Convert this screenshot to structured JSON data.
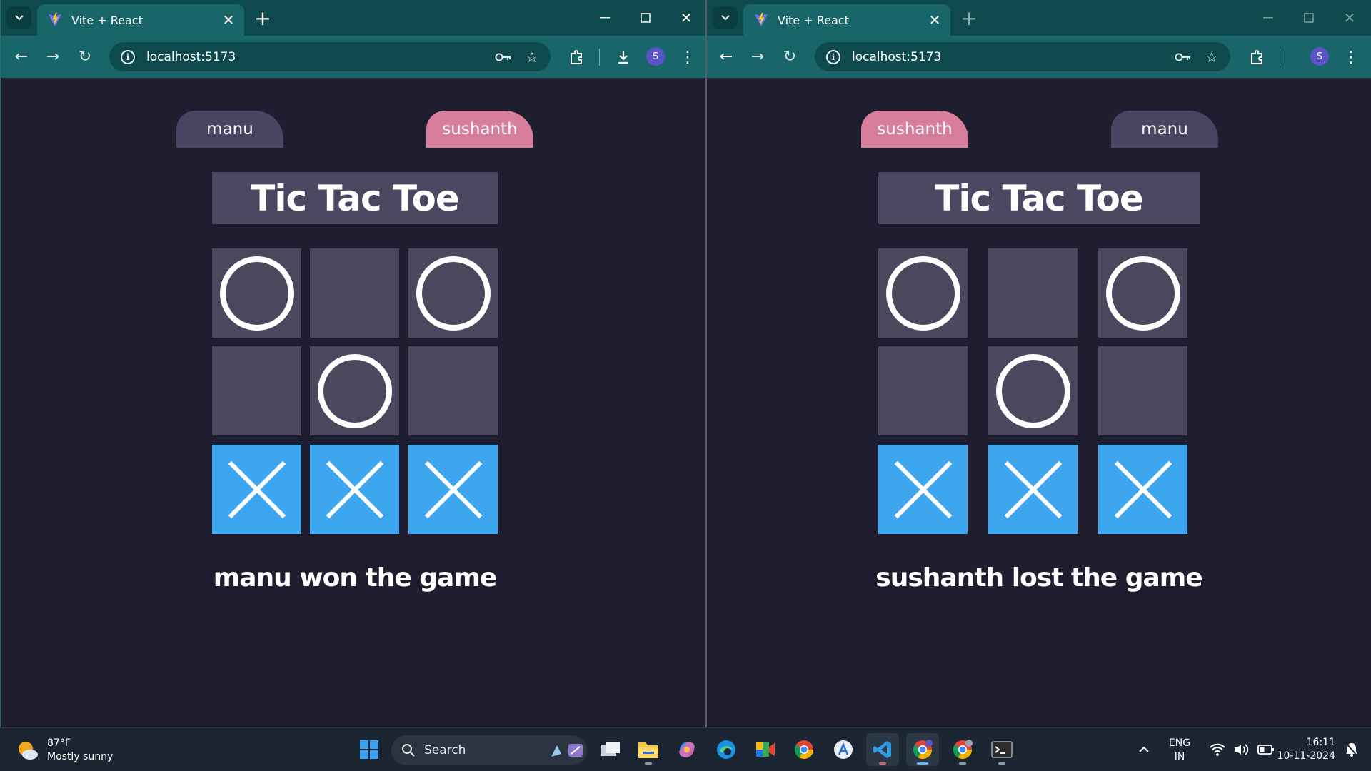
{
  "browsers": [
    {
      "id": "left",
      "tab_title": "Vite + React",
      "url": "localhost:5173",
      "profile_initial": "S",
      "players": [
        {
          "name": "manu",
          "active": false
        },
        {
          "name": "sushanth",
          "active": true
        }
      ],
      "game_title": "Tic Tac Toe",
      "board": [
        "O",
        "",
        "O",
        "",
        "O",
        "",
        "X",
        "X",
        "X"
      ],
      "status": "manu won the game"
    },
    {
      "id": "right",
      "tab_title": "Vite + React",
      "url": "localhost:5173",
      "profile_initial": "S",
      "players": [
        {
          "name": "sushanth",
          "active": true
        },
        {
          "name": "manu",
          "active": false
        }
      ],
      "game_title": "Tic Tac Toe",
      "board": [
        "O",
        "",
        "O",
        "",
        "O",
        "",
        "X",
        "X",
        "X"
      ],
      "status": "sushanth lost the game"
    }
  ],
  "colors": {
    "page_bg": "#1f1e31",
    "cell_bg": "#4b485e",
    "x_cell_bg": "#3ea6ef",
    "active_player_bg": "#d87d9b",
    "player_bg": "#484562",
    "chrome_dark": "#0e4a4d",
    "chrome_light": "#19666a"
  },
  "taskbar": {
    "weather_temp": "87°F",
    "weather_desc": "Mostly sunny",
    "search_placeholder": "Search",
    "lang_top": "ENG",
    "lang_bottom": "IN",
    "time": "16:11",
    "date": "10-11-2024",
    "apps": [
      "start-icon",
      "task-view-icon",
      "file-explorer-icon",
      "copilot-icon",
      "edge-icon",
      "meet-icon",
      "chrome-icon",
      "app-store-icon",
      "vscode-icon",
      "chrome-profile-icon",
      "chrome-extra-icon",
      "terminal-icon"
    ]
  }
}
